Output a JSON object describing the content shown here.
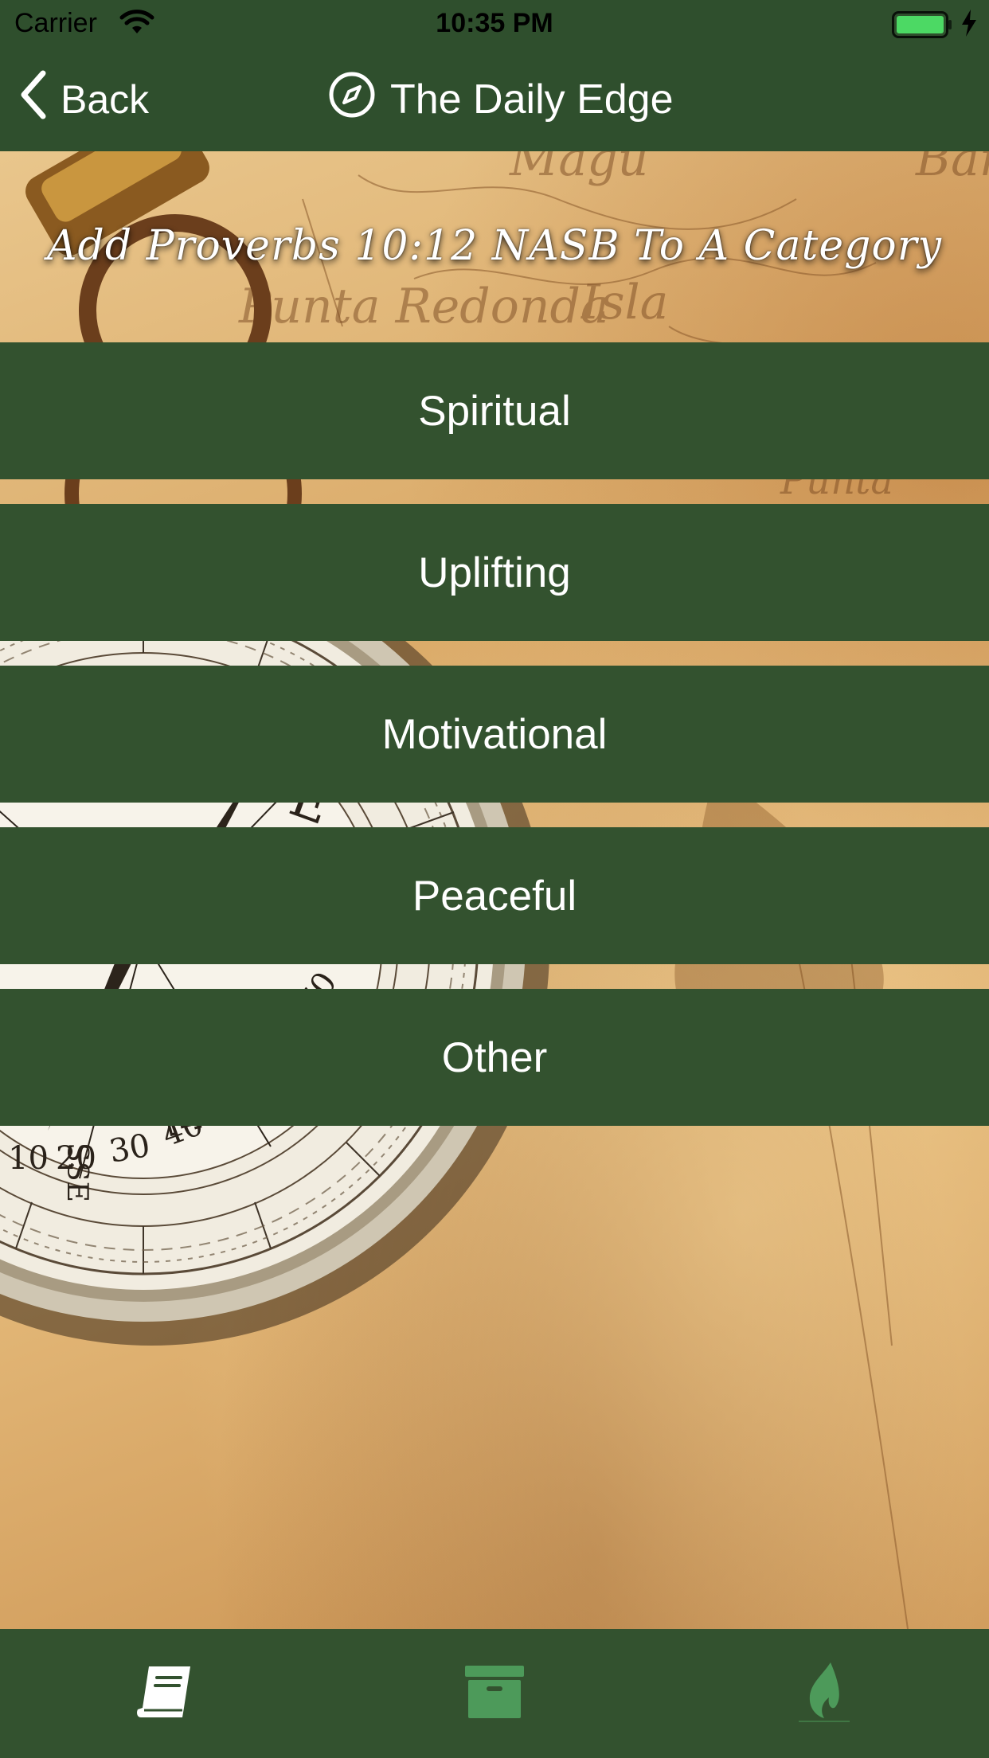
{
  "status_bar": {
    "carrier": "Carrier",
    "time": "10:35 PM"
  },
  "nav": {
    "back_label": "Back",
    "title": "The Daily Edge"
  },
  "header": {
    "title": "Add Proverbs 10:12 NASB To A Category"
  },
  "categories": [
    {
      "label": "Spiritual"
    },
    {
      "label": "Uplifting"
    },
    {
      "label": "Motivational"
    },
    {
      "label": "Peaceful"
    },
    {
      "label": "Other"
    }
  ],
  "tabs": [
    {
      "icon": "book-icon",
      "selected": true
    },
    {
      "icon": "archive-box-icon",
      "selected": false
    },
    {
      "icon": "flame-icon",
      "selected": false
    }
  ],
  "colors": {
    "nav_bar": "#2f4f2d",
    "button": "#33522f",
    "tab_active": "#ffffff",
    "tab_inactive": "#4d9a5a",
    "battery": "#4cd964"
  }
}
